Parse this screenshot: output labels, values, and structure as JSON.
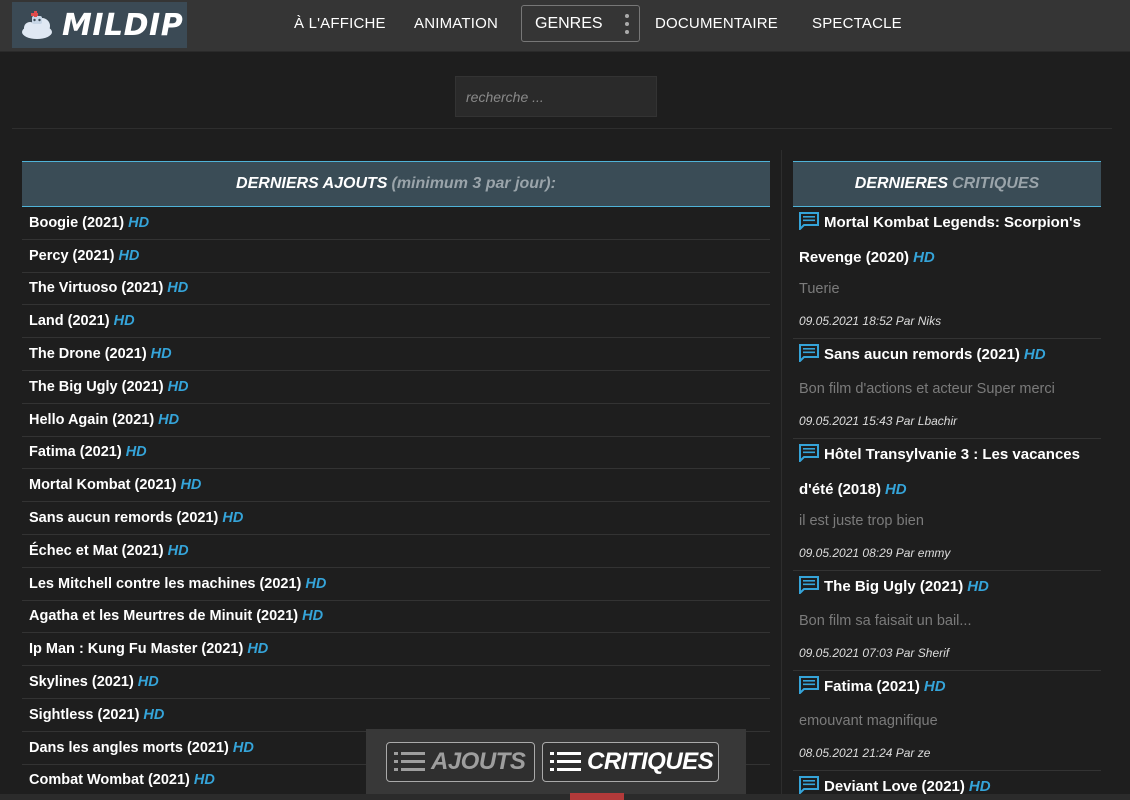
{
  "brand": {
    "name": "MILDIP",
    "logo_icon": "robot-cloud-icon"
  },
  "nav": {
    "items": [
      "À L'AFFICHE",
      "ANIMATION",
      "DOCUMENTAIRE",
      "SPECTACLE"
    ],
    "genres_label": "GENRES",
    "genres_icon": "vertical-dots-icon"
  },
  "search": {
    "placeholder": "recherche ..."
  },
  "latest": {
    "title": "DERNIERS AJOUTS",
    "subtitle": "(minimum 3 par jour):",
    "items": [
      {
        "title": "Boogie (2021)",
        "badge": "HD"
      },
      {
        "title": "Percy (2021)",
        "badge": "HD"
      },
      {
        "title": "The Virtuoso (2021)",
        "badge": "HD"
      },
      {
        "title": "Land (2021)",
        "badge": "HD"
      },
      {
        "title": "The Drone (2021)",
        "badge": "HD"
      },
      {
        "title": "The Big Ugly (2021)",
        "badge": "HD"
      },
      {
        "title": "Hello Again (2021)",
        "badge": "HD"
      },
      {
        "title": "Fatima (2021)",
        "badge": "HD"
      },
      {
        "title": "Mortal Kombat (2021)",
        "badge": "HD"
      },
      {
        "title": "Sans aucun remords (2021)",
        "badge": "HD"
      },
      {
        "title": "Échec et Mat (2021)",
        "badge": "HD"
      },
      {
        "title": "Les Mitchell contre les machines (2021)",
        "badge": "HD"
      },
      {
        "title": "Agatha et les Meurtres de Minuit (2021)",
        "badge": "HD"
      },
      {
        "title": "Ip Man : Kung Fu Master (2021)",
        "badge": "HD"
      },
      {
        "title": "Skylines (2021)",
        "badge": "HD"
      },
      {
        "title": "Sightless (2021)",
        "badge": "HD"
      },
      {
        "title": "Dans les angles morts (2021)",
        "badge": "HD"
      },
      {
        "title": "Combat Wombat (2021)",
        "badge": "HD"
      }
    ]
  },
  "reviews": {
    "title": "DERNIERES",
    "title_dim": "CRITIQUES",
    "items": [
      {
        "title": "Mortal Kombat Legends: Scorpion's Revenge (2020)",
        "badge": "HD",
        "text": "Tuerie",
        "meta": "09.05.2021 18:52 Par Niks"
      },
      {
        "title": "Sans aucun remords (2021)",
        "badge": "HD",
        "text": "Bon film d'actions et acteur Super merci",
        "meta": "09.05.2021 15:43 Par Lbachir"
      },
      {
        "title": "Hôtel Transylvanie 3 : Les vacances d'été (2018)",
        "badge": "HD",
        "text": "il est juste trop bien",
        "meta": "09.05.2021 08:29 Par emmy"
      },
      {
        "title": "The Big Ugly (2021)",
        "badge": "HD",
        "text": "Bon film sa faisait un bail...",
        "meta": "09.05.2021 07:03 Par Sherif"
      },
      {
        "title": "Fatima (2021)",
        "badge": "HD",
        "text": "emouvant magnifique",
        "meta": "08.05.2021 21:24 Par ze"
      },
      {
        "title": "Deviant Love (2021)",
        "badge": "HD",
        "text": "",
        "meta": ""
      }
    ]
  },
  "bottom_tabs": {
    "ajouts": "AJOUTS",
    "critiques": "CRITIQUES",
    "icon": "list-icon"
  },
  "colors": {
    "accent": "#35a4d9",
    "header_bg": "#3a4c56",
    "nav_bg": "#353535",
    "page_bg": "#1e1e1e"
  }
}
